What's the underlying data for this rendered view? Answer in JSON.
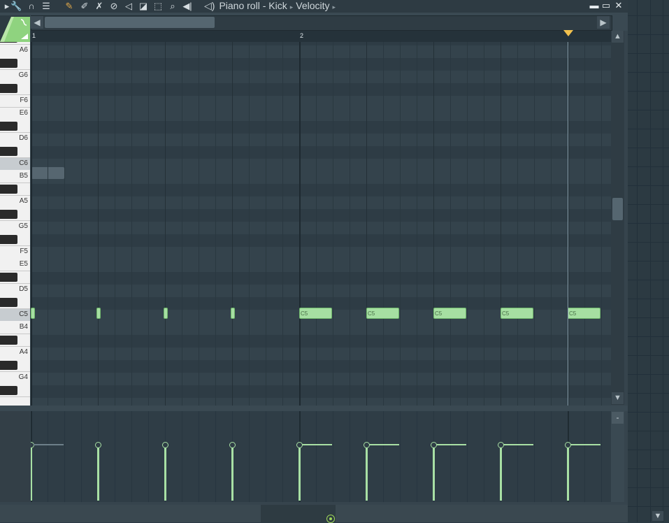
{
  "titlebar": {
    "title_parts": [
      "Piano roll",
      "Kick",
      "Velocity"
    ],
    "title_dash": " - ",
    "window_buttons": [
      "minimize",
      "maximize",
      "close"
    ],
    "tools": [
      "wrench-icon",
      "magnet-icon",
      "menu-icon",
      "pencil-icon",
      "paint-icon",
      "delete-icon",
      "mute-icon",
      "slice-icon",
      "select-icon",
      "zoom-icon",
      "playback-icon"
    ]
  },
  "ruler": {
    "bars": [
      "1",
      "2"
    ]
  },
  "keyboard": {
    "labels": [
      "A6",
      "G6",
      "F6",
      "E6",
      "D6",
      "C6",
      "B5",
      "A5",
      "G5",
      "F5",
      "E5",
      "D5",
      "C5",
      "B4",
      "A4",
      "G4"
    ],
    "highlighted": [
      "C6",
      "C5"
    ]
  },
  "notes": {
    "pitch": "C5",
    "items": [
      {
        "step": 0,
        "label": "",
        "short": true
      },
      {
        "step": 1,
        "label": "",
        "short": true
      },
      {
        "step": 2,
        "label": "",
        "short": true
      },
      {
        "step": 3,
        "label": "",
        "short": true
      },
      {
        "step": 4,
        "label": "C5",
        "short": false
      },
      {
        "step": 5,
        "label": "C5",
        "short": false
      },
      {
        "step": 6,
        "label": "C5",
        "short": false
      },
      {
        "step": 7,
        "label": "C5",
        "short": false
      },
      {
        "step": 8,
        "label": "C5",
        "short": false
      }
    ]
  },
  "velocity": {
    "levels": [
      0.8,
      0.8,
      0.8,
      0.8,
      0.8,
      0.8,
      0.8,
      0.8,
      0.8
    ]
  },
  "colors": {
    "note_fill": "#a6dfa2",
    "note_border": "#6fb66b",
    "grid_bg": "#34434c",
    "playhead_marker": "#f2c14e",
    "accent_green": "#9fd85a"
  },
  "icons": {
    "scroll_left": "◀",
    "scroll_right": "▶",
    "scroll_up": "▲",
    "scroll_down": "▼",
    "minus": "-",
    "minimize": "▬",
    "maximize": "▭",
    "close": "✕"
  }
}
